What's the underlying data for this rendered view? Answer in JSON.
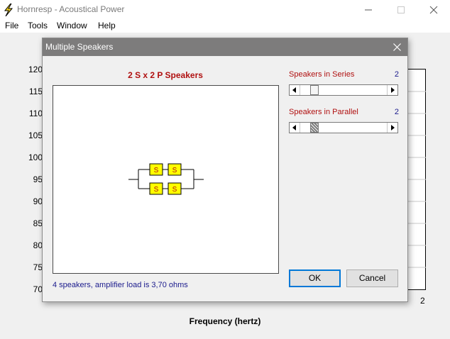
{
  "app": {
    "title": "Hornresp - Acoustical Power"
  },
  "menu": {
    "file": "File",
    "tools": "Tools",
    "window": "Window",
    "help": "Help"
  },
  "graph": {
    "y_ticks": [
      "120",
      "115",
      "110",
      "105",
      "100",
      "95",
      "90",
      "85",
      "80",
      "75",
      "70"
    ],
    "x_axis_label": "Frequency (hertz)",
    "x_end_label": "2"
  },
  "dialog": {
    "title": "Multiple Speakers",
    "configuration_title": "2 S x 2 P Speakers",
    "speaker_glyph": "S",
    "status_text": "4 speakers, amplifier load is 3,70 ohms",
    "series": {
      "label": "Speakers in Series",
      "value": "2"
    },
    "parallel": {
      "label": "Speakers in Parallel",
      "value": "2"
    },
    "ok_label": "OK",
    "cancel_label": "Cancel"
  },
  "colors": {
    "label_red": "#b01010",
    "value_blue": "#1a1a8c",
    "dialog_titlebar": "#7d7c7c",
    "speaker_fill": "#ffff00"
  }
}
